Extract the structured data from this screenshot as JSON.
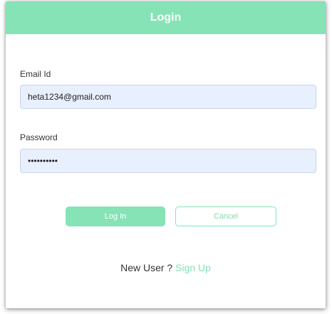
{
  "header": {
    "title": "Login"
  },
  "form": {
    "email": {
      "label": "Email Id",
      "value": "heta1234@gmail.com"
    },
    "password": {
      "label": "Password",
      "value": "••••••••••"
    }
  },
  "buttons": {
    "login_label": "Log In",
    "cancel_label": "Cancel"
  },
  "signup": {
    "prompt": "New User ? ",
    "link_label": "Sign Up"
  },
  "colors": {
    "accent": "#86e3b6",
    "input_bg": "#e8effd"
  }
}
